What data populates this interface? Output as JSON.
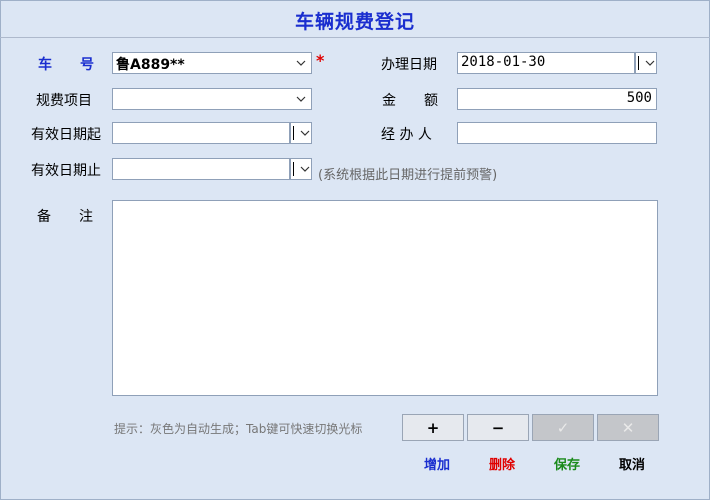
{
  "window": {
    "title": "车辆规费登记"
  },
  "form": {
    "plate": {
      "label": "车　　号",
      "value": "鲁A889**",
      "required_mark": "*"
    },
    "fee_item": {
      "label": "规费项目",
      "value": ""
    },
    "valid_from": {
      "label": "有效日期起",
      "value": ""
    },
    "valid_to": {
      "label": "有效日期止",
      "value": "",
      "hint": "(系统根据此日期进行提前预警)"
    },
    "handle_date": {
      "label": "办理日期",
      "value": "2018-01-30"
    },
    "amount": {
      "label": "金　　额",
      "value": "500"
    },
    "handler": {
      "label": "经 办 人",
      "value": ""
    },
    "remark": {
      "label": "备　　注",
      "value": ""
    }
  },
  "tip": "提示：灰色为自动生成；Tab键可快速切换光标",
  "buttons": {
    "add": {
      "symbol": "+",
      "label": "增加",
      "color": "#1a2ecf"
    },
    "delete": {
      "symbol": "−",
      "label": "删除",
      "color": "#e00000"
    },
    "save": {
      "symbol": "✓",
      "label": "保存",
      "color": "#1a8a1a"
    },
    "cancel": {
      "symbol": "✕",
      "label": "取消",
      "color": "#000000"
    }
  },
  "colors": {
    "background": "#dce6f4",
    "title": "#1a2ecf",
    "required": "#e00000"
  }
}
